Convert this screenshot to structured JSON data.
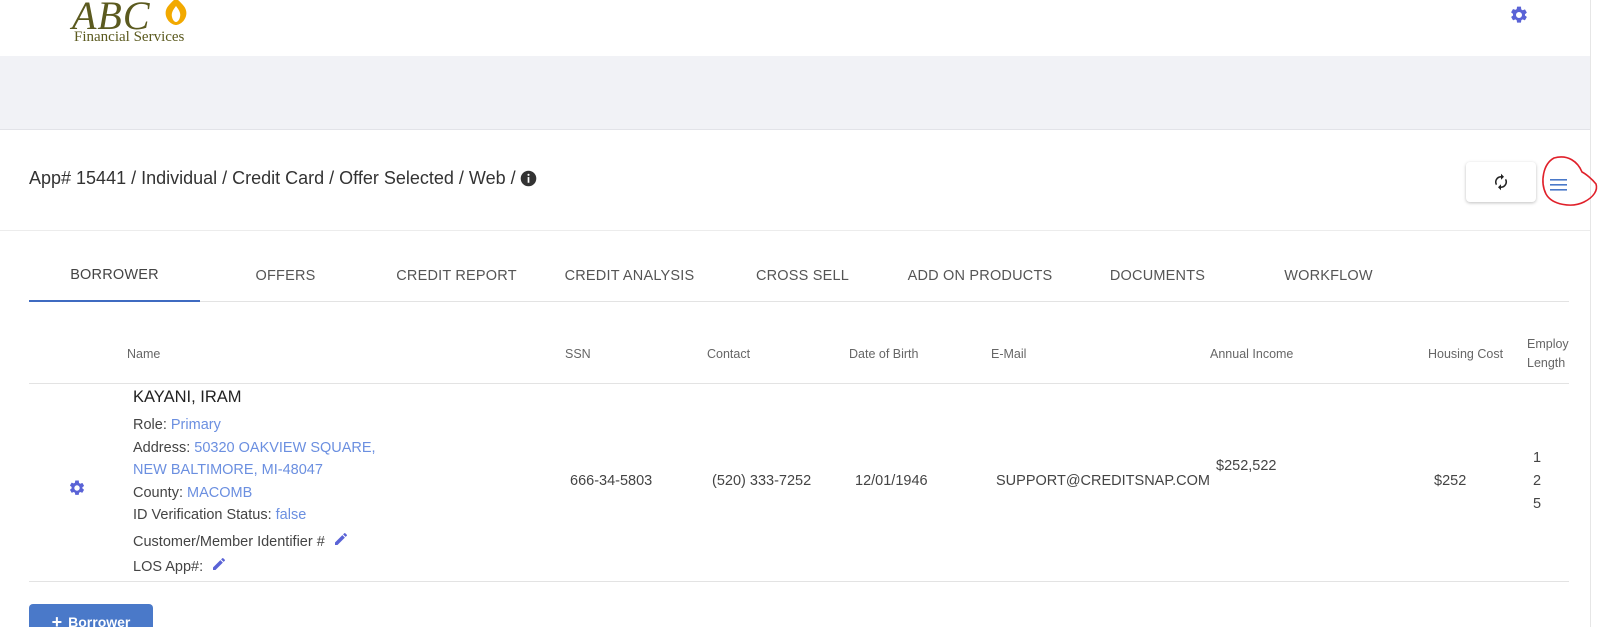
{
  "brand": {
    "logo_text": "ABC",
    "logo_subtitle": "Financial Services",
    "accent": "#4a79c9",
    "icon_color": "#5a63d6"
  },
  "app": {
    "title": "App# 15441 / Individual / Credit Card / Offer Selected / Web /",
    "info_icon": "info-icon",
    "refresh_icon": "refresh-icon",
    "menu_icon": "hamburger-menu-icon"
  },
  "tabs": [
    {
      "label": "BORROWER",
      "active": true
    },
    {
      "label": "OFFERS",
      "active": false
    },
    {
      "label": "CREDIT REPORT",
      "active": false
    },
    {
      "label": "CREDIT ANALYSIS",
      "active": false
    },
    {
      "label": "CROSS SELL",
      "active": false
    },
    {
      "label": "ADD ON PRODUCTS",
      "active": false
    },
    {
      "label": "DOCUMENTS",
      "active": false
    },
    {
      "label": "WORKFLOW",
      "active": false
    }
  ],
  "table": {
    "headers": {
      "name": "Name",
      "ssn": "SSN",
      "contact": "Contact",
      "dob": "Date of Birth",
      "email": "E-Mail",
      "income": "Annual Income",
      "housing": "Housing Cost",
      "employ_line1": "Employ",
      "employ_line2": "Length"
    },
    "row": {
      "name": "KAYANI, IRAM",
      "role_label": "Role:",
      "role_value": "Primary",
      "address_label": "Address:",
      "address_line1": "50320 OAKVIEW SQUARE,",
      "address_line2": "NEW BALTIMORE, MI-48047",
      "county_label": "County:",
      "county_value": "MACOMB",
      "idv_label": "ID Verification Status:",
      "idv_value": "false",
      "cust_id_label": "Customer/Member Identifier #",
      "los_label": "LOS App#:",
      "ssn": "666-34-5803",
      "contact": "(520) 333-7252",
      "dob": "12/01/1946",
      "email": "SUPPORT@CREDITSNAP.COM",
      "income": "$252,522",
      "housing": "$252",
      "employ_1": "1",
      "employ_2": "2",
      "employ_3": "5"
    }
  },
  "actions": {
    "add_borrower": "Borrower",
    "add_plus": "+"
  }
}
